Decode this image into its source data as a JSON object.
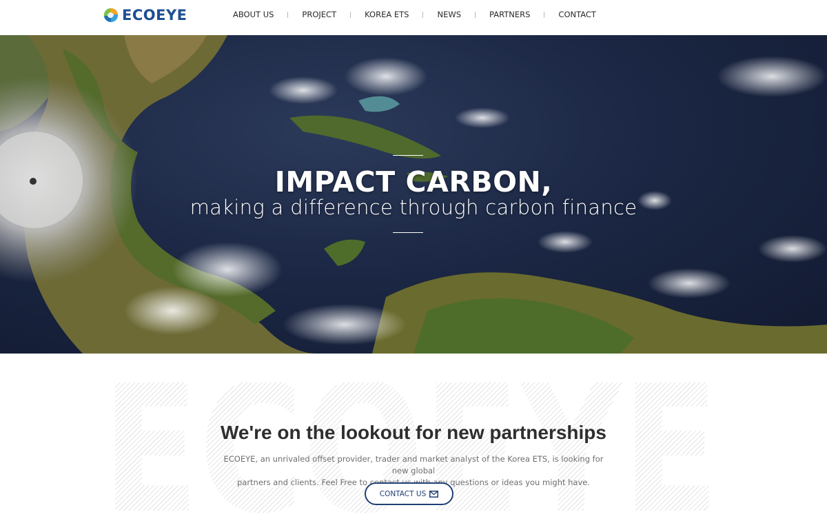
{
  "brand": {
    "name": "ECOEYE",
    "accent": "#1d4e93"
  },
  "nav": {
    "items": [
      "ABOUT US",
      "PROJECT",
      "KOREA ETS",
      "NEWS",
      "PARTNERS",
      "CONTACT"
    ]
  },
  "hero": {
    "title": "IMPACT CARBON,",
    "subtitle": "making a difference through carbon finance"
  },
  "partner": {
    "watermark": "ECOEYE",
    "heading": "We're on the lookout for new partnerships",
    "body_line1": "ECOEYE, an unrivaled offset provider, trader and market analyst of the Korea ETS, is looking for new global",
    "body_line2": "partners and clients. Feel Free to contact us with any questions or ideas you might have.",
    "button_label": "CONTACT US",
    "button_icon": "mail-icon",
    "button_color": "#1f3f74"
  }
}
